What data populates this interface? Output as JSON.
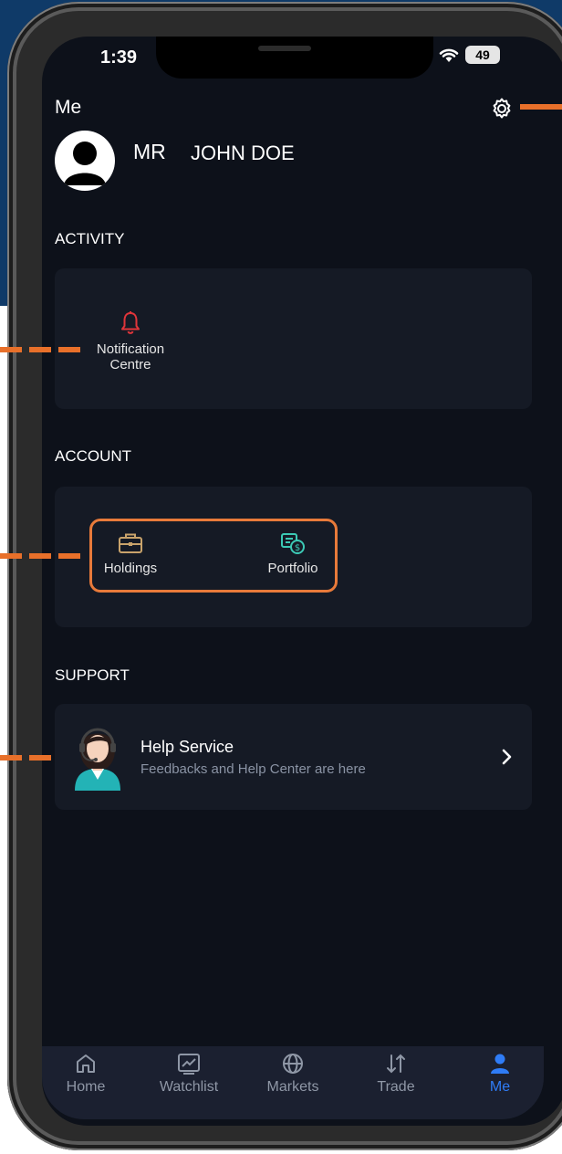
{
  "status": {
    "time": "1:39",
    "battery": "49"
  },
  "header": {
    "title": "Me",
    "name_prefix": "MR",
    "name": "JOHN DOE"
  },
  "activity": {
    "label": "ACTIVITY",
    "items": [
      {
        "label_line1": "Notification",
        "label_line2": "Centre",
        "icon": "bell-icon"
      }
    ]
  },
  "account": {
    "label": "ACCOUNT",
    "items": [
      {
        "label": "Holdings",
        "icon": "briefcase-icon"
      },
      {
        "label": "Portfolio",
        "icon": "portfolio-icon"
      }
    ]
  },
  "support": {
    "label": "SUPPORT",
    "help_title": "Help Service",
    "help_subtitle": "Feedbacks and Help Center are here"
  },
  "nav": {
    "items": [
      {
        "label": "Home"
      },
      {
        "label": "Watchlist"
      },
      {
        "label": "Markets"
      },
      {
        "label": "Trade"
      },
      {
        "label": "Me"
      }
    ]
  },
  "colors": {
    "accent": "#2f7cf6",
    "annotation": "#e8702a",
    "bell": "#e0353a",
    "briefcase": "#c9a36b",
    "portfolio": "#3cc9b5",
    "background": "#0d111a",
    "card": "#151a25"
  }
}
